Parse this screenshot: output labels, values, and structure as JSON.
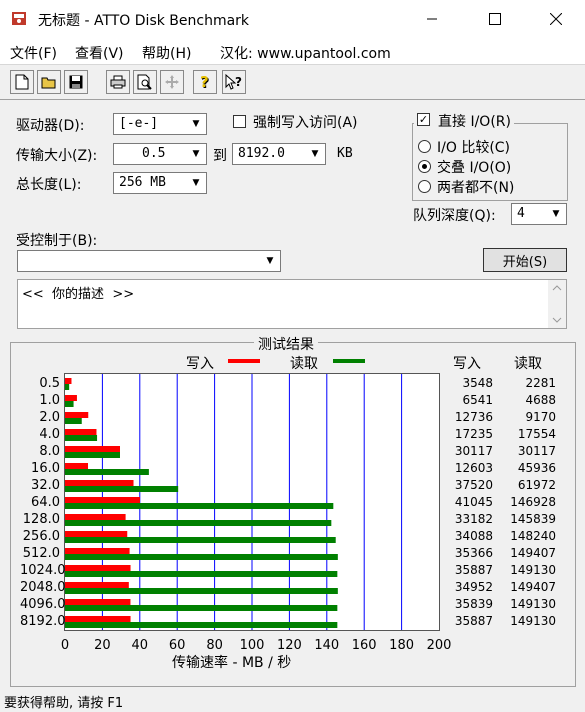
{
  "window": {
    "title": "无标题 - ATTO Disk Benchmark"
  },
  "menu": [
    {
      "label": "文件(F)"
    },
    {
      "label": "查看(V)"
    },
    {
      "label": "帮助(H)"
    },
    {
      "label": "汉化: www.upantool.com"
    }
  ],
  "toolbar": [
    "new-doc-icon",
    "open-folder-icon",
    "save-icon",
    "print-icon",
    "print-preview-icon",
    "move-icon",
    "help-icon",
    "context-help-icon"
  ],
  "form": {
    "drive_label": "驱动器(D):",
    "drive_value": "[-e-]",
    "force_write_label": "强制写入访问(A)",
    "transfer_label": "传输大小(Z):",
    "transfer_from": "0.5",
    "transfer_to_label": "到",
    "transfer_to": "8192.0",
    "transfer_unit": "KB",
    "total_label": "总长度(L):",
    "total_value": "256 MB",
    "controlled_label": "受控制于(B):",
    "description": "<<  你的描述  >>",
    "direct_io_label": "直接 I/O(R)",
    "io_compare_label": "I/O 比较(C)",
    "overlap_io_label": "交叠 I/O(O)",
    "neither_label": "两者都不(N)",
    "queue_label": "队列深度(Q):",
    "queue_value": "4",
    "start_button": "开始(S)"
  },
  "results": {
    "title": "测试结果",
    "write_legend": "写入",
    "read_legend": "读取",
    "col_write": "写入",
    "col_read": "读取",
    "xlabel": "传输速率 - MB / 秒",
    "colors": {
      "write": "#ff0000",
      "read": "#008000",
      "grid": "#0000ff"
    }
  },
  "chart_data": {
    "type": "bar",
    "orientation": "horizontal",
    "categories": [
      "0.5",
      "1.0",
      "2.0",
      "4.0",
      "8.0",
      "16.0",
      "32.0",
      "64.0",
      "128.0",
      "256.0",
      "512.0",
      "1024.0",
      "2048.0",
      "4096.0",
      "8192.0"
    ],
    "series": [
      {
        "name": "写入",
        "values": [
          3548,
          6541,
          12736,
          17235,
          30117,
          12603,
          37520,
          41045,
          33182,
          34088,
          35366,
          35887,
          34952,
          35839,
          35887
        ]
      },
      {
        "name": "读取",
        "values": [
          2281,
          4688,
          9170,
          17554,
          30117,
          45936,
          61972,
          146928,
          145839,
          148240,
          149407,
          149130,
          149407,
          149130,
          149130
        ]
      }
    ],
    "xticks": [
      "0",
      "20",
      "40",
      "60",
      "80",
      "100",
      "120",
      "140",
      "160",
      "180",
      "200"
    ],
    "xlim": [
      0,
      200
    ],
    "xlabel": "传输速率 - MB / 秒"
  },
  "status": {
    "text": "要获得帮助, 请按 F1"
  }
}
